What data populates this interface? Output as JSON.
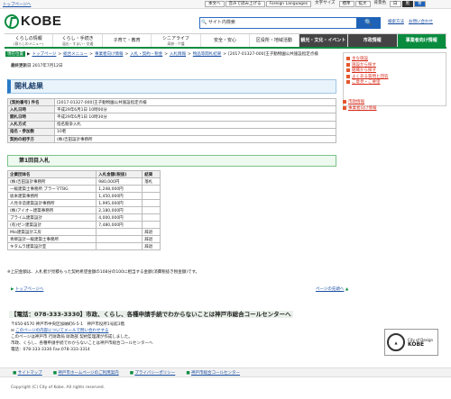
{
  "util": {
    "top_link": "トップページへ",
    "items": [
      "本文へ",
      "音声で読み上げる",
      "Foreign Languages",
      "文字サイズ",
      "標準",
      "拡大",
      "背景色",
      "白",
      "黒",
      "青"
    ]
  },
  "header": {
    "logo_text": "KOBE",
    "search_label": "サイト内検索",
    "search_placeholder": "",
    "search_button": "検索",
    "links": [
      "検索方法",
      "お問い合わせ"
    ]
  },
  "nav": [
    {
      "label": "くらしの情報",
      "sub": "(暮らしのメニュー)"
    },
    {
      "label": "くらし・手続き",
      "sub": "届出・すまい・交通"
    },
    {
      "label": "子育て・教育",
      "sub": ""
    },
    {
      "label": "シニアライフ",
      "sub": "高齢・介護"
    },
    {
      "label": "安全・安心",
      "sub": ""
    },
    {
      "label": "区役所・地域活動",
      "sub": ""
    },
    {
      "label": "観光・文化・イベント",
      "sub": ""
    },
    {
      "label": "市政情報",
      "sub": ""
    },
    {
      "label": "事業者向け情報",
      "sub": ""
    }
  ],
  "breadcrumb": {
    "here": "現在位置",
    "items": [
      "トップページ",
      "総合メニュー",
      "事業者向け情報",
      "入札・契約・税金",
      "入札情報",
      "物品等開札結果",
      "[2017-01327-000]王子動物園公共施設指定点検"
    ]
  },
  "updated": {
    "label": "最終更新日",
    "value": "2017年7月12日"
  },
  "title": "開札結果",
  "info": [
    {
      "h": "[契約番号] 件名",
      "v": "[2017-01327-000]王子動物園公共施設指定点検"
    },
    {
      "h": "入札日時",
      "v": "平成29年6月1日 10時00分"
    },
    {
      "h": "開札日時",
      "v": "平成29年6月1日 10時30分"
    },
    {
      "h": "入札方式",
      "v": "指名競争入札"
    },
    {
      "h": "指名・参加数",
      "v": "10者"
    },
    {
      "h": "契約の相手方",
      "v": "(株)吉田設計事務所"
    }
  ],
  "round_title": "第1回目入札",
  "bids": {
    "headers": [
      "企業団体名",
      "入札金額(税抜)",
      "結果"
    ],
    "rows": [
      [
        "(株)吉田設計事務所",
        "980,000円",
        "落札"
      ],
      [
        "一級建築士事務所 プラーマTBG",
        "1,248,000円",
        ""
      ],
      [
        "坂本建築事務所",
        "1,450,000円",
        ""
      ],
      [
        "人見幸造建築設計事務所",
        "1,995,000円",
        ""
      ],
      [
        "(株)アイオー建築事務所",
        "2,180,000円",
        ""
      ],
      [
        "プライム建築設計",
        "4,000,000円",
        ""
      ],
      [
        "(有)ゼン建築設計",
        "7,480,000円",
        ""
      ],
      [
        "Mio建築設計工房",
        "",
        "辞退"
      ],
      [
        "青柳設計一級建築士事務所",
        "",
        "辞退"
      ],
      [
        "キタムラ建築設計室",
        "",
        "辞退"
      ]
    ]
  },
  "note": "※上記金額は、入札者が見積もった契約希望金額の108分の100に相当する金額(消費税抜き税金額)です。",
  "page_top": "トップページへ",
  "page_back": "ページの先頭へ",
  "side1": [
    "主な施設",
    "施設から探す",
    "組織から探す",
    "よくある質問と回答",
    "ご意見・ご要望"
  ],
  "side2": [
    "市政情報",
    "事業者向け情報"
  ],
  "footer": {
    "title": "【電話：078-333-3330】市政、くらし、各種申請手続でわからないことは神戸市総合コールセンターへ",
    "lines": [
      "〒650-8570 神戸市中央区加納町6-5-1　神戸市役所1号館3階",
      "このページの内容についてメールで問い合わせする",
      "このページは神戸市 行財政局 財政部 契約監理課が作成しました。",
      "市政、くらし、各種申請手続でわからないことは神戸市総合コールセンターへ",
      "電話：078-333-3330 Fax:078-333-3314"
    ],
    "cod_text": [
      "City of Design",
      "KOBE"
    ],
    "nav": [
      "サイトマップ",
      "神戸市ホームページのご利用案内",
      "プライバシーポリシー",
      "神戸市総合コールセンター"
    ],
    "copyright": "Copyright (C) City of Kobe. All rights reserved."
  }
}
